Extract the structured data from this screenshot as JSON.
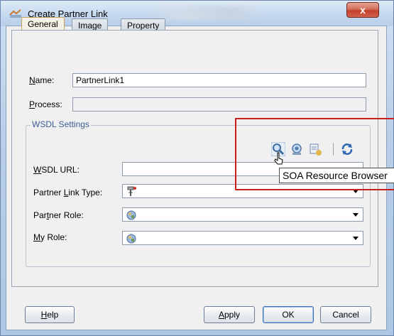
{
  "window": {
    "title": "Create Partner Link",
    "close_label": "x"
  },
  "tabs": [
    {
      "label": "General",
      "active": true
    },
    {
      "label": "Image",
      "active": false
    },
    {
      "label": "Property",
      "active": false
    }
  ],
  "form": {
    "name_label_u": "N",
    "name_label_rest": "ame:",
    "name_value": "PartnerLink1",
    "process_label_u": "P",
    "process_label_rest": "rocess:",
    "process_value": ""
  },
  "wsdl": {
    "legend": "WSDL Settings",
    "url_label_u": "W",
    "url_label_rest": "SDL URL:",
    "url_value": "",
    "partner_link_type_label_pre": "Partner ",
    "partner_link_type_label_u": "L",
    "partner_link_type_label_post": "ink Type:",
    "partner_role_label_pre": "Par",
    "partner_role_label_u": "t",
    "partner_role_label_post": "ner Role:",
    "my_role_label_u": "M",
    "my_role_label_rest": "y Role:",
    "toolbar_icons": [
      "search-icon",
      "find-service-icon",
      "browse-service-icon",
      "refresh-icon"
    ]
  },
  "tooltip": "SOA Resource Browser",
  "buttons": {
    "help_u": "H",
    "help_rest": "elp",
    "apply_u": "A",
    "apply_rest": "pply",
    "ok": "OK",
    "cancel": "Cancel"
  },
  "colors": {
    "highlight": "#c81e1e",
    "legend_text": "#3a5e96",
    "active_tab_border": "#c9a25c"
  }
}
